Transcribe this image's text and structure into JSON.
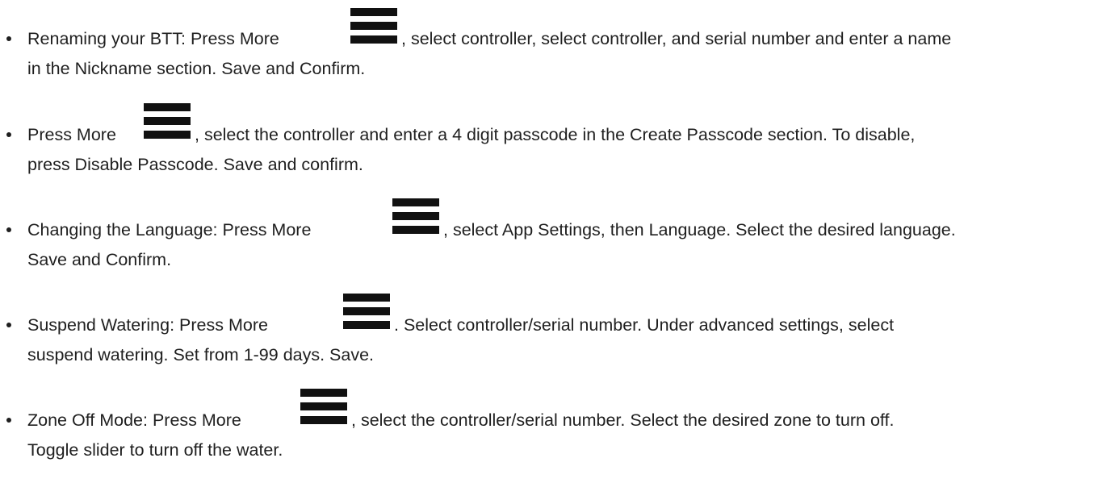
{
  "icons": {
    "more_menu": "hamburger-menu-icon"
  },
  "instructions": [
    {
      "before_icon": "Renaming your BTT: Press More ",
      "after_icon": ", select controller, select controller, and serial number and enter a name",
      "line2": "in the Nickname section. Save and Confirm."
    },
    {
      "before_icon": "Press More ",
      "after_icon": ", select the controller and enter a 4 digit passcode in the Create Passcode section. To disable,",
      "line2": "press Disable Passcode. Save and confirm."
    },
    {
      "before_icon": "Changing the Language: Press More ",
      "after_icon": ", select App Settings, then Language. Select the desired language.",
      "line2": "Save and Confirm."
    },
    {
      "before_icon": "Suspend Watering: Press More ",
      "after_icon": ". Select controller/serial number. Under advanced settings, select",
      "line2": "suspend watering. Set from 1-99 days. Save."
    },
    {
      "before_icon": "Zone Off Mode: Press More ",
      "after_icon": ", select the controller/serial number. Select the desired zone to turn off.",
      "line2": "Toggle slider to turn off the water."
    }
  ]
}
